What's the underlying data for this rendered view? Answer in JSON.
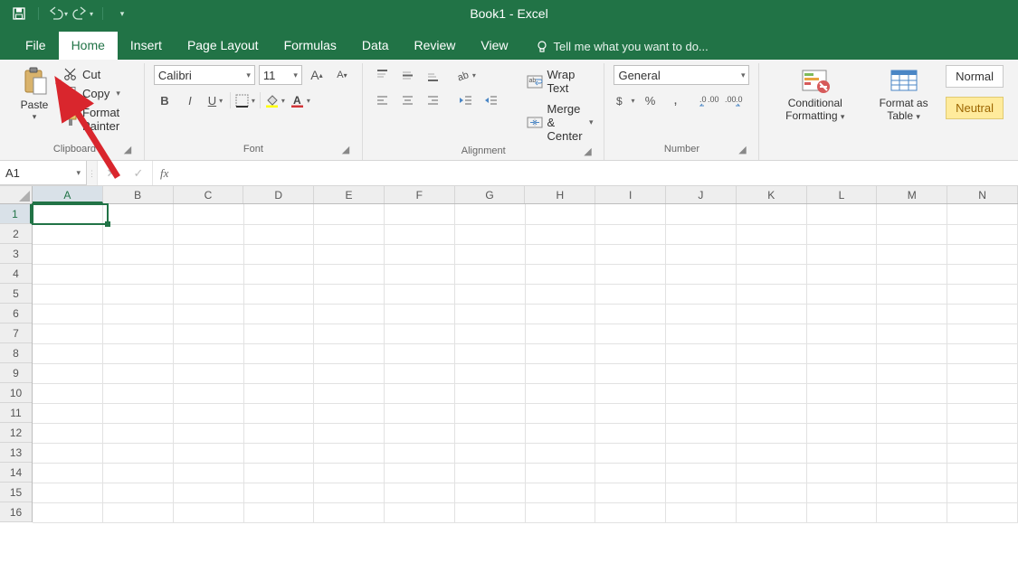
{
  "title": "Book1 - Excel",
  "qat": {
    "save": "save-icon",
    "undo": "undo-icon",
    "redo": "redo-icon"
  },
  "tabs": [
    "File",
    "Home",
    "Insert",
    "Page Layout",
    "Formulas",
    "Data",
    "Review",
    "View"
  ],
  "active_tab": "Home",
  "tellme": "Tell me what you want to do...",
  "ribbon": {
    "clipboard": {
      "label": "Clipboard",
      "paste": "Paste",
      "cut": "Cut",
      "copy": "Copy",
      "format_painter": "Format Painter"
    },
    "font": {
      "label": "Font",
      "name": "Calibri",
      "size": "11",
      "bold": "B",
      "italic": "I",
      "underline": "U"
    },
    "alignment": {
      "label": "Alignment",
      "wrap": "Wrap Text",
      "merge": "Merge & Center"
    },
    "number": {
      "label": "Number",
      "format": "General"
    },
    "styles": {
      "conditional": "Conditional Formatting",
      "table": "Format as Table",
      "normal": "Normal",
      "neutral": "Neutral"
    }
  },
  "namebox": "A1",
  "fx_label": "fx",
  "formula": "",
  "grid": {
    "columns": [
      "A",
      "B",
      "C",
      "D",
      "E",
      "F",
      "G",
      "H",
      "I",
      "J",
      "K",
      "L",
      "M",
      "N"
    ],
    "rows": [
      1,
      2,
      3,
      4,
      5,
      6,
      7,
      8,
      9,
      10,
      11,
      12,
      13,
      14,
      15,
      16
    ],
    "selected_cell": "A1"
  }
}
